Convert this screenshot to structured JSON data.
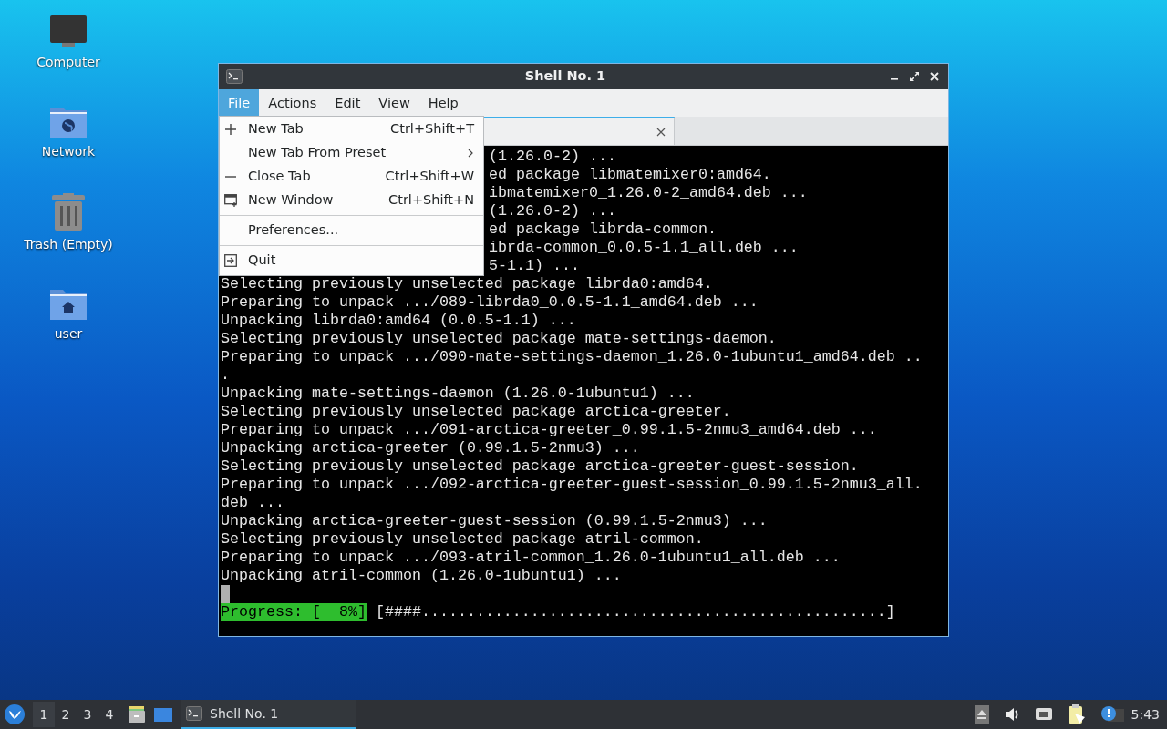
{
  "desktop_icons": [
    {
      "label": "Computer"
    },
    {
      "label": "Network"
    },
    {
      "label": "Trash (Empty)"
    },
    {
      "label": "user"
    }
  ],
  "window": {
    "title": "Shell No. 1",
    "menubar": [
      {
        "label": "File",
        "selected": true
      },
      {
        "label": "Actions",
        "selected": false
      },
      {
        "label": "Edit",
        "selected": false
      },
      {
        "label": "View",
        "selected": false
      },
      {
        "label": "Help",
        "selected": false
      }
    ],
    "file_menu": [
      {
        "kind": "item",
        "label": "New Tab",
        "shortcut": "Ctrl+Shift+T"
      },
      {
        "kind": "item",
        "label": "New Tab From Preset",
        "has_submenu": true
      },
      {
        "kind": "item",
        "label": "Close Tab",
        "shortcut": "Ctrl+Shift+W"
      },
      {
        "kind": "item",
        "label": "New Window",
        "shortcut": "Ctrl+Shift+N"
      },
      {
        "kind": "separator"
      },
      {
        "kind": "item",
        "label": "Preferences..."
      },
      {
        "kind": "separator"
      },
      {
        "kind": "item",
        "label": "Quit"
      }
    ],
    "tabs": [
      {
        "selected": true
      }
    ],
    "terminal_lines": [
      {
        "kind": "covered",
        "text": "(1.26.0-2) ..."
      },
      {
        "kind": "covered",
        "text": "ed package libmatemixer0:amd64."
      },
      {
        "kind": "covered",
        "text": "ibmatemixer0_1.26.0-2_amd64.deb ..."
      },
      {
        "kind": "covered",
        "text": "(1.26.0-2) ..."
      },
      {
        "kind": "covered",
        "text": "ed package librda-common."
      },
      {
        "kind": "covered",
        "text": "ibrda-common_0.0.5-1.1_all.deb ..."
      },
      {
        "kind": "covered",
        "text": "5-1.1) ..."
      },
      {
        "kind": "line",
        "text": "Selecting previously unselected package librda0:amd64."
      },
      {
        "kind": "line",
        "text": "Preparing to unpack .../089-librda0_0.0.5-1.1_amd64.deb ..."
      },
      {
        "kind": "line",
        "text": "Unpacking librda0:amd64 (0.0.5-1.1) ..."
      },
      {
        "kind": "line",
        "text": "Selecting previously unselected package mate-settings-daemon."
      },
      {
        "kind": "line",
        "text": "Preparing to unpack .../090-mate-settings-daemon_1.26.0-1ubuntu1_amd64.deb .."
      },
      {
        "kind": "line",
        "text": "."
      },
      {
        "kind": "line",
        "text": "Unpacking mate-settings-daemon (1.26.0-1ubuntu1) ..."
      },
      {
        "kind": "line",
        "text": "Selecting previously unselected package arctica-greeter."
      },
      {
        "kind": "line",
        "text": "Preparing to unpack .../091-arctica-greeter_0.99.1.5-2nmu3_amd64.deb ..."
      },
      {
        "kind": "line",
        "text": "Unpacking arctica-greeter (0.99.1.5-2nmu3) ..."
      },
      {
        "kind": "line",
        "text": "Selecting previously unselected package arctica-greeter-guest-session."
      },
      {
        "kind": "line",
        "text": "Preparing to unpack .../092-arctica-greeter-guest-session_0.99.1.5-2nmu3_all."
      },
      {
        "kind": "line",
        "text": "deb ..."
      },
      {
        "kind": "line",
        "text": "Unpacking arctica-greeter-guest-session (0.99.1.5-2nmu3) ..."
      },
      {
        "kind": "line",
        "text": "Selecting previously unselected package atril-common."
      },
      {
        "kind": "line",
        "text": "Preparing to unpack .../093-atril-common_1.26.0-1ubuntu1_all.deb ..."
      },
      {
        "kind": "line",
        "text": "Unpacking atril-common (1.26.0-1ubuntu1) ..."
      },
      {
        "kind": "cursor"
      },
      {
        "kind": "progress",
        "label": "Progress: [  8%]",
        "bar": "[####...................................................]"
      }
    ]
  },
  "taskbar": {
    "workspaces": [
      {
        "label": "1",
        "selected": true
      },
      {
        "label": "2",
        "selected": false
      },
      {
        "label": "3",
        "selected": false
      },
      {
        "label": "4",
        "selected": false
      }
    ],
    "tasks": [
      {
        "label": "Shell No. 1",
        "selected": true
      }
    ],
    "clock": "5:43"
  }
}
